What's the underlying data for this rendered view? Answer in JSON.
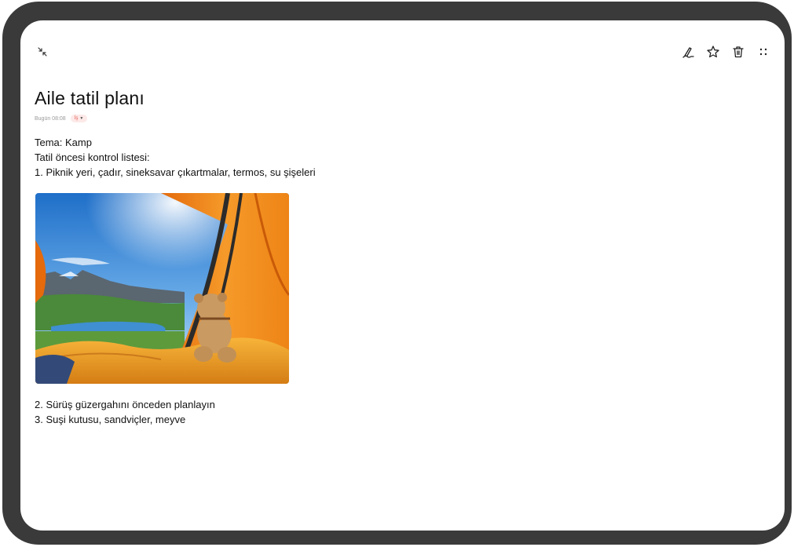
{
  "toolbar": {
    "collapse_icon": "collapse-icon",
    "draw_icon": "handwriting-icon",
    "favorite_icon": "star-icon",
    "delete_icon": "trash-icon",
    "more_icon": "more-icon"
  },
  "note": {
    "title": "Aile tatil planı",
    "timestamp": "Bugün 08:08",
    "category": "İş",
    "lines_before_image": [
      "Tema: Kamp",
      "Tatil öncesi kontrol listesi:",
      "1. Piknik yeri, çadır, sineksavar çıkartmalar, termos, su şişeleri"
    ],
    "lines_after_image": [
      "2. Sürüş güzergahını önceden planlayın",
      "3. Suşi kutusu, sandviçler, meyve"
    ]
  },
  "colors": {
    "device_frame": "#3a3a3a",
    "tag_background": "#fde9e8",
    "tag_text": "#e2584e",
    "tent_orange": "#f08a1c",
    "sky_blue": "#4f9be0"
  }
}
